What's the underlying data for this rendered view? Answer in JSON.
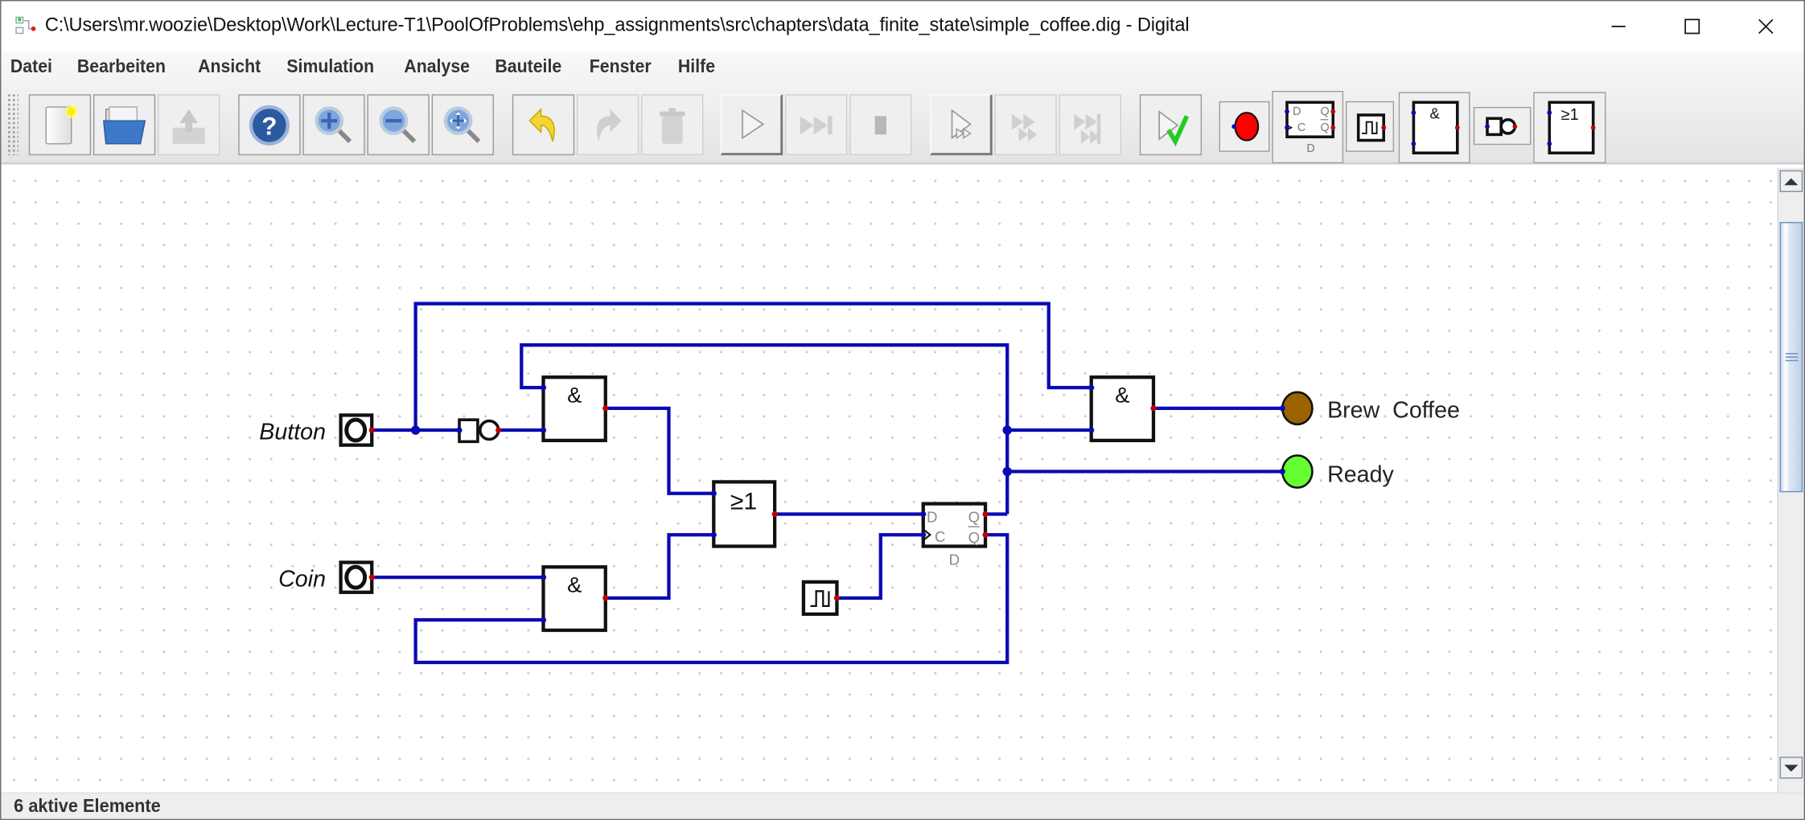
{
  "window": {
    "title": "C:\\Users\\mr.woozie\\Desktop\\Work\\Lecture-T1\\PoolOfProblems\\ehp_assignments\\src\\chapters\\data_finite_state\\simple_coffee.dig - Digital",
    "app_icon": "digital-app-icon",
    "controls": {
      "minimize": "minimize-icon",
      "maximize": "maximize-icon",
      "close": "close-icon"
    }
  },
  "menubar": {
    "items": [
      {
        "label": "Datei"
      },
      {
        "label": "Bearbeiten"
      },
      {
        "label": "Ansicht"
      },
      {
        "label": "Simulation"
      },
      {
        "label": "Analyse"
      },
      {
        "label": "Bauteile"
      },
      {
        "label": "Fenster"
      },
      {
        "label": "Hilfe"
      }
    ]
  },
  "toolbar": {
    "buttons": [
      {
        "name": "new-file",
        "icon": "new-file-icon",
        "enabled": true
      },
      {
        "name": "open-file",
        "icon": "folder-open-icon",
        "enabled": true
      },
      {
        "name": "save-file",
        "icon": "save-icon",
        "enabled": false
      },
      {
        "name": "help",
        "icon": "help-icon",
        "enabled": true
      },
      {
        "name": "zoom-in",
        "icon": "zoom-in-icon",
        "enabled": true
      },
      {
        "name": "zoom-out",
        "icon": "zoom-out-icon",
        "enabled": true
      },
      {
        "name": "zoom-fit",
        "icon": "zoom-fit-icon",
        "enabled": true
      },
      {
        "name": "undo",
        "icon": "undo-icon",
        "enabled": true
      },
      {
        "name": "redo",
        "icon": "redo-icon",
        "enabled": false
      },
      {
        "name": "delete",
        "icon": "trash-icon",
        "enabled": false
      },
      {
        "name": "run-simulation",
        "icon": "play-icon",
        "enabled": true
      },
      {
        "name": "step",
        "icon": "step-forward-icon",
        "enabled": false
      },
      {
        "name": "stop",
        "icon": "stop-icon",
        "enabled": false
      },
      {
        "name": "run-to-break",
        "icon": "micro-step-icon",
        "enabled": true
      },
      {
        "name": "fast-run",
        "icon": "fast-forward-icon",
        "enabled": false
      },
      {
        "name": "run-to-end",
        "icon": "run-to-end-icon",
        "enabled": false
      },
      {
        "name": "run-tests",
        "icon": "test-check-icon",
        "enabled": true
      }
    ],
    "recent_components": [
      {
        "name": "led",
        "icon": "led-icon"
      },
      {
        "name": "d-flipflop",
        "icon": "d-flipflop-icon",
        "labels": {
          "d": "D",
          "c": "C",
          "q": "Q",
          "qn": "Q",
          "name": "D"
        }
      },
      {
        "name": "clock",
        "icon": "clock-icon"
      },
      {
        "name": "and-gate",
        "icon": "and-gate-icon",
        "symbol": "&"
      },
      {
        "name": "not-gate",
        "icon": "not-gate-icon"
      },
      {
        "name": "or-gate",
        "icon": "or-gate-icon",
        "symbol": "≥1"
      }
    ]
  },
  "circuit": {
    "inputs": [
      {
        "label": "Button"
      },
      {
        "label": "Coin"
      }
    ],
    "gates": {
      "and_symbol": "&",
      "or_symbol": "≥1"
    },
    "flipflop": {
      "d": "D",
      "c": "C",
      "q": "Q",
      "qn": "Q",
      "name": "D"
    },
    "outputs": [
      {
        "label": "Brew  Coffee",
        "color": "#9b6200"
      },
      {
        "label": "Ready",
        "color": "#66ff33"
      }
    ],
    "colors": {
      "wire": "#0a0ab4",
      "output_pin": "#c00000",
      "input_pin": "#0a0ab4"
    }
  },
  "statusbar": {
    "text": "6 aktive Elemente"
  },
  "scrollbar": {
    "vertical_position": 0.1,
    "visible_fraction": 0.48
  }
}
